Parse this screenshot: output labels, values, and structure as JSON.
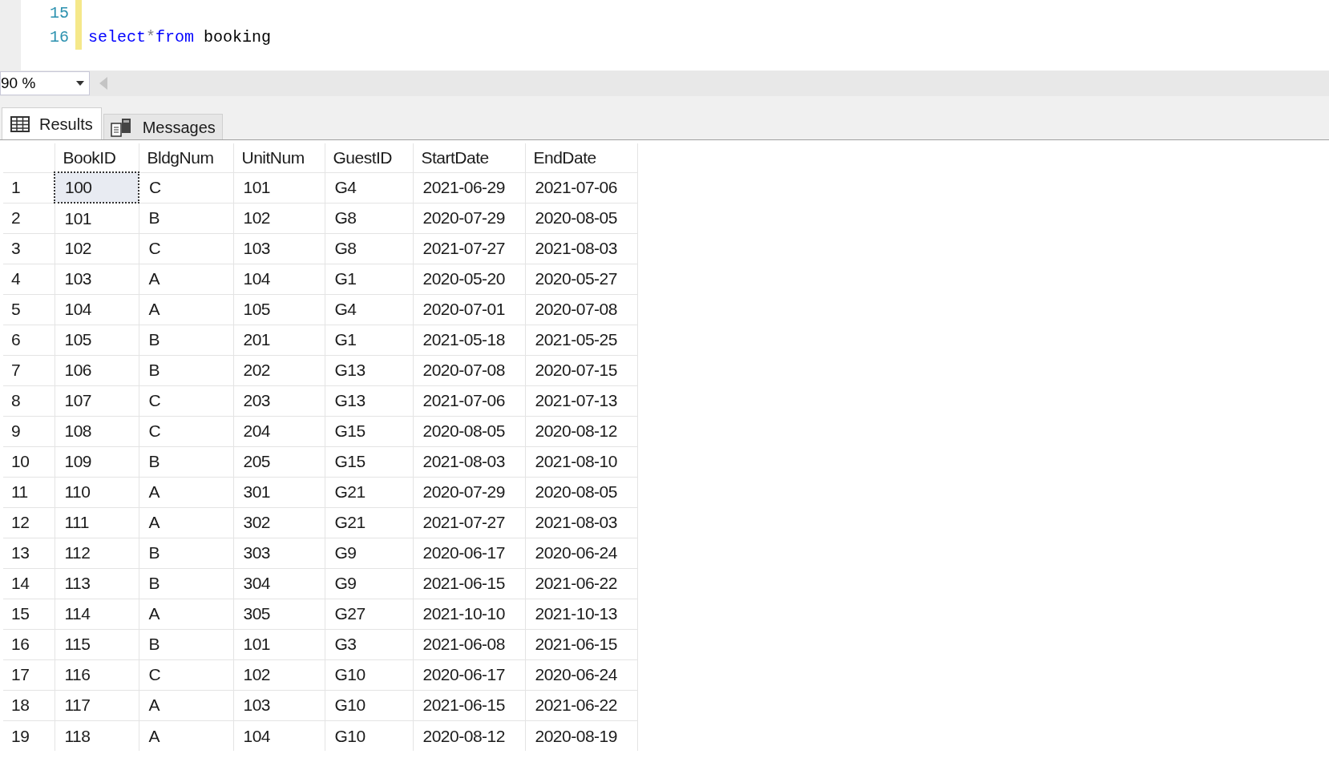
{
  "editor": {
    "lines": [
      {
        "number": "15"
      },
      {
        "number": "16",
        "tokens": [
          {
            "kind": "keyword",
            "text": "select"
          },
          {
            "kind": "operator",
            "text": "*"
          },
          {
            "kind": "keyword",
            "text": "from"
          },
          {
            "kind": "plain",
            "text": " booking"
          }
        ]
      }
    ]
  },
  "zoom": {
    "value": "90 %"
  },
  "tabs": [
    {
      "label": "Results",
      "selected": true
    },
    {
      "label": "Messages",
      "selected": false
    }
  ],
  "table": {
    "columns": [
      "BookID",
      "BldgNum",
      "UnitNum",
      "GuestID",
      "StartDate",
      "EndDate"
    ],
    "rows": [
      {
        "number": "1",
        "focused": true,
        "cells": [
          "100",
          "C",
          "101",
          "G4",
          "2021-06-29",
          "2021-07-06"
        ]
      },
      {
        "number": "2",
        "focused": false,
        "cells": [
          "101",
          "B",
          "102",
          "G8",
          "2020-07-29",
          "2020-08-05"
        ]
      },
      {
        "number": "3",
        "focused": false,
        "cells": [
          "102",
          "C",
          "103",
          "G8",
          "2021-07-27",
          "2021-08-03"
        ]
      },
      {
        "number": "4",
        "focused": false,
        "cells": [
          "103",
          "A",
          "104",
          "G1",
          "2020-05-20",
          "2020-05-27"
        ]
      },
      {
        "number": "5",
        "focused": false,
        "cells": [
          "104",
          "A",
          "105",
          "G4",
          "2020-07-01",
          "2020-07-08"
        ]
      },
      {
        "number": "6",
        "focused": false,
        "cells": [
          "105",
          "B",
          "201",
          "G1",
          "2021-05-18",
          "2021-05-25"
        ]
      },
      {
        "number": "7",
        "focused": false,
        "cells": [
          "106",
          "B",
          "202",
          "G13",
          "2020-07-08",
          "2020-07-15"
        ]
      },
      {
        "number": "8",
        "focused": false,
        "cells": [
          "107",
          "C",
          "203",
          "G13",
          "2021-07-06",
          "2021-07-13"
        ]
      },
      {
        "number": "9",
        "focused": false,
        "cells": [
          "108",
          "C",
          "204",
          "G15",
          "2020-08-05",
          "2020-08-12"
        ]
      },
      {
        "number": "10",
        "focused": false,
        "cells": [
          "109",
          "B",
          "205",
          "G15",
          "2021-08-03",
          "2021-08-10"
        ]
      },
      {
        "number": "11",
        "focused": false,
        "cells": [
          "110",
          "A",
          "301",
          "G21",
          "2020-07-29",
          "2020-08-05"
        ]
      },
      {
        "number": "12",
        "focused": false,
        "cells": [
          "111",
          "A",
          "302",
          "G21",
          "2021-07-27",
          "2021-08-03"
        ]
      },
      {
        "number": "13",
        "focused": false,
        "cells": [
          "112",
          "B",
          "303",
          "G9",
          "2020-06-17",
          "2020-06-24"
        ]
      },
      {
        "number": "14",
        "focused": false,
        "cells": [
          "113",
          "B",
          "304",
          "G9",
          "2021-06-15",
          "2021-06-22"
        ]
      },
      {
        "number": "15",
        "focused": false,
        "cells": [
          "114",
          "A",
          "305",
          "G27",
          "2021-10-10",
          "2021-10-13"
        ]
      },
      {
        "number": "16",
        "focused": false,
        "cells": [
          "115",
          "B",
          "101",
          "G3",
          "2021-06-08",
          "2021-06-15"
        ]
      },
      {
        "number": "17",
        "focused": false,
        "cells": [
          "116",
          "C",
          "102",
          "G10",
          "2020-06-17",
          "2020-06-24"
        ]
      },
      {
        "number": "18",
        "focused": false,
        "cells": [
          "117",
          "A",
          "103",
          "G10",
          "2021-06-15",
          "2021-06-22"
        ]
      },
      {
        "number": "19",
        "focused": false,
        "cells": [
          "118",
          "A",
          "104",
          "G10",
          "2020-08-12",
          "2020-08-19"
        ]
      }
    ]
  }
}
